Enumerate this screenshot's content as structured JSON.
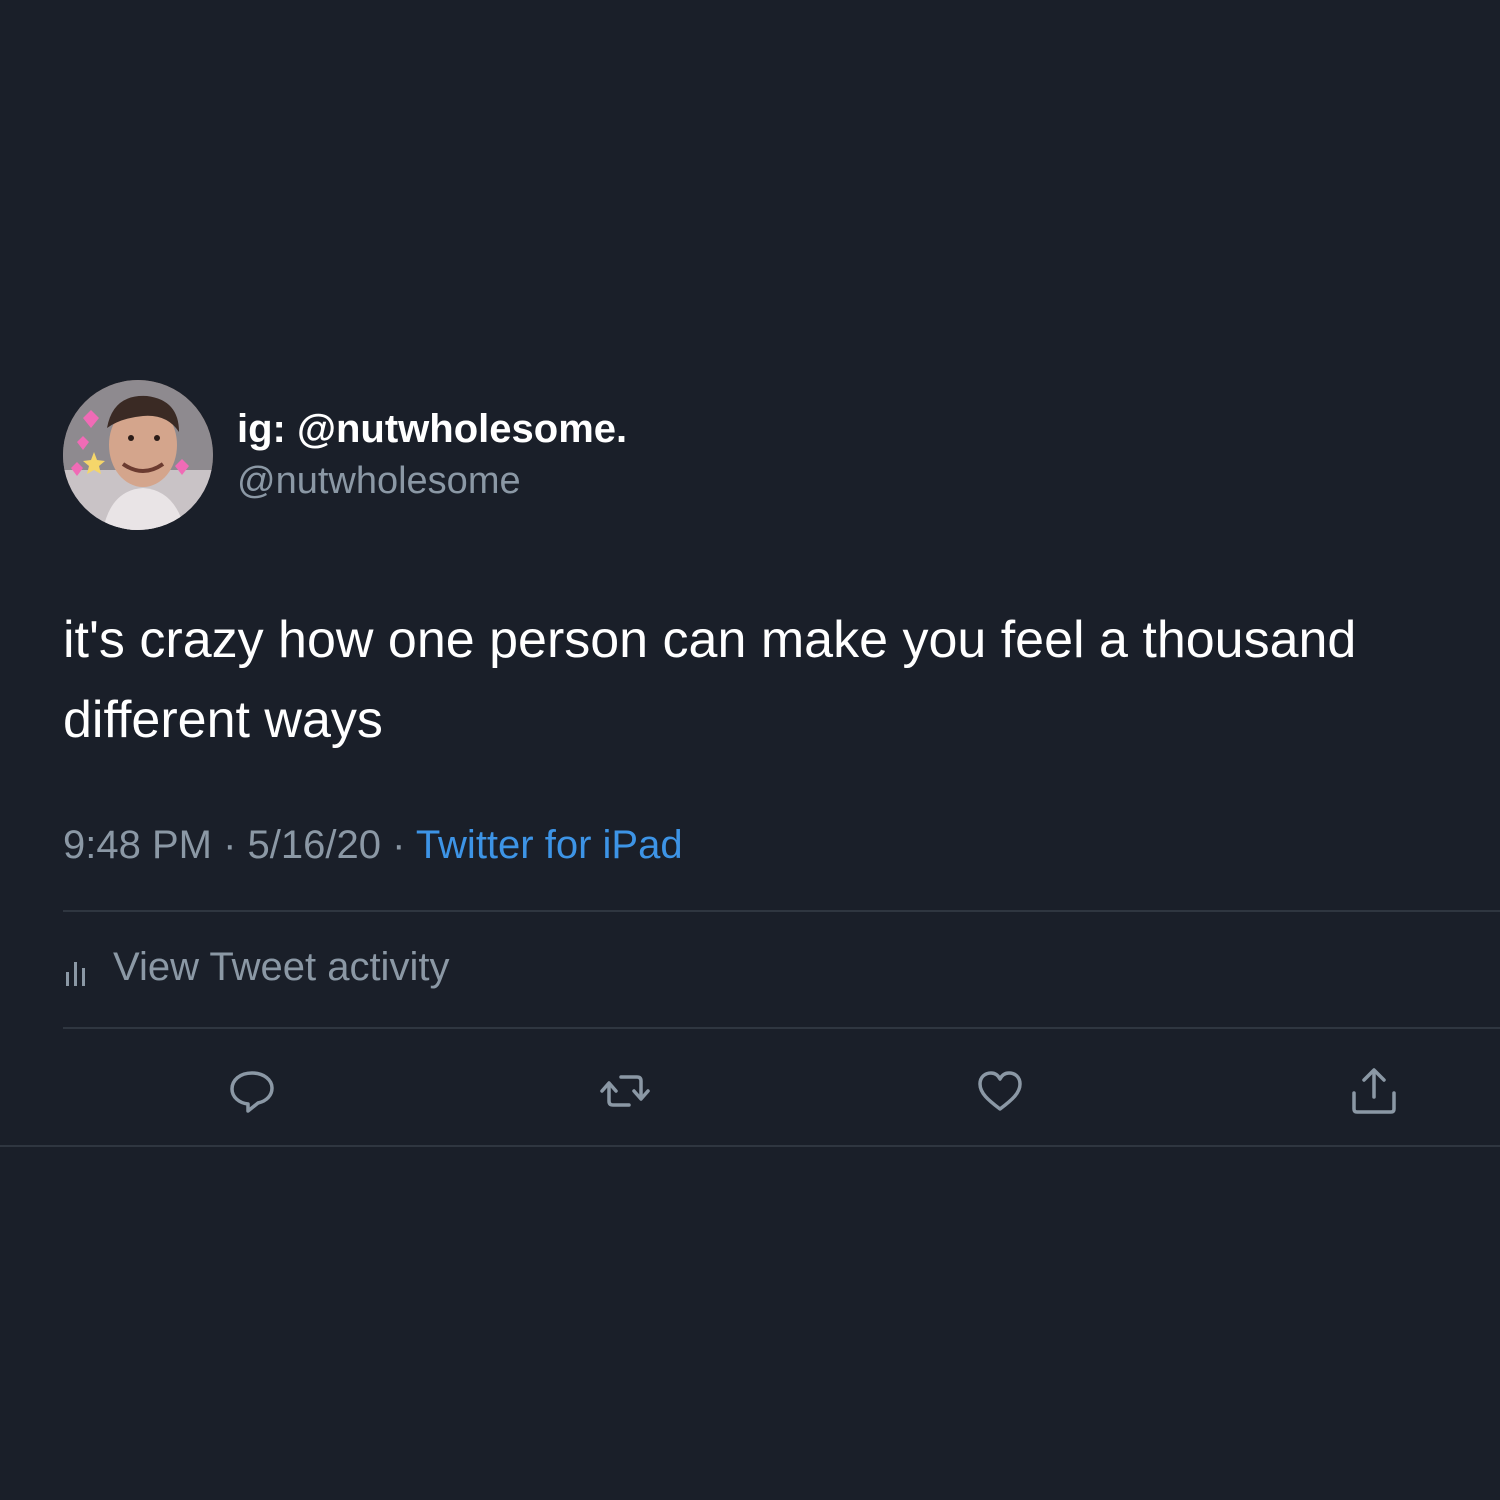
{
  "author": {
    "display_name": "ig: @nutwholesome.",
    "handle": "@nutwholesome"
  },
  "tweet": {
    "text": "it's crazy how one person can make you feel a thousand different ways"
  },
  "meta": {
    "time": "9:48 PM",
    "separator_1": " · ",
    "date": "5/16/20",
    "separator_2": " · ",
    "source": "Twitter for iPad"
  },
  "activity": {
    "label": "View Tweet activity",
    "icon": "bar-chart-icon"
  },
  "actions": {
    "reply_icon": "reply-icon",
    "retweet_icon": "retweet-icon",
    "like_icon": "heart-icon",
    "share_icon": "share-icon"
  },
  "colors": {
    "background": "#1a1f29",
    "primary_text": "#ffffff",
    "secondary_text": "#8b98a5",
    "link": "#3d94e6",
    "divider": "#2f3640"
  }
}
